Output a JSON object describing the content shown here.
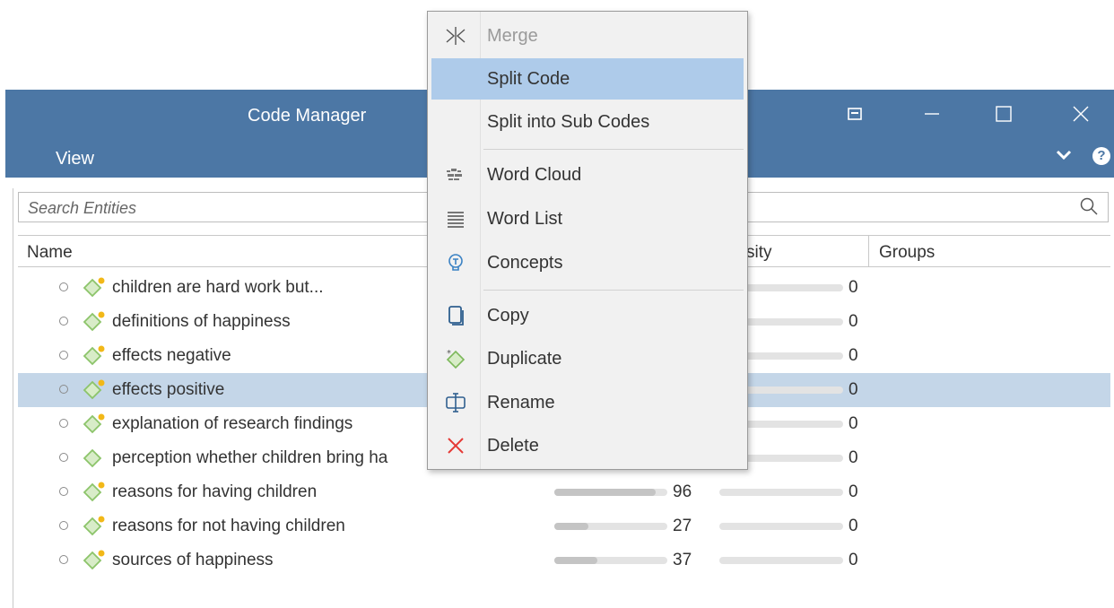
{
  "window": {
    "title": "Code Manager"
  },
  "menubar": {
    "view": "View"
  },
  "search": {
    "placeholder": "Search Entities"
  },
  "columns": {
    "name": "Name",
    "density": "sity",
    "groups": "Groups"
  },
  "rows": [
    {
      "label": "children are hard work but...",
      "grounded": "",
      "density": "0",
      "gfill": null,
      "selected": false,
      "dot": true
    },
    {
      "label": "definitions of happiness",
      "grounded": "",
      "density": "0",
      "gfill": null,
      "selected": false,
      "dot": true
    },
    {
      "label": "effects negative",
      "grounded": "",
      "density": "0",
      "gfill": null,
      "selected": false,
      "dot": true
    },
    {
      "label": "effects positive",
      "grounded": "",
      "density": "0",
      "gfill": null,
      "selected": true,
      "dot": true
    },
    {
      "label": "explanation of research findings",
      "grounded": "",
      "density": "0",
      "gfill": null,
      "selected": false,
      "dot": true
    },
    {
      "label": "perception whether children bring ha",
      "grounded": "",
      "density": "0",
      "gfill": null,
      "selected": false,
      "dot": false
    },
    {
      "label": "reasons for having children",
      "grounded": "96",
      "density": "0",
      "gfill": 0.9,
      "selected": false,
      "dot": true
    },
    {
      "label": "reasons for not having children",
      "grounded": "27",
      "density": "0",
      "gfill": 0.3,
      "selected": false,
      "dot": true
    },
    {
      "label": "sources of happiness",
      "grounded": "37",
      "density": "0",
      "gfill": 0.38,
      "selected": false,
      "dot": true
    }
  ],
  "context_menu": {
    "merge": "Merge",
    "split_code": "Split Code",
    "split_sub": "Split into Sub Codes",
    "word_cloud": "Word Cloud",
    "word_list": "Word List",
    "concepts": "Concepts",
    "copy": "Copy",
    "duplicate": "Duplicate",
    "rename": "Rename",
    "delete": "Delete"
  },
  "colors": {
    "accent": "#4c77a5",
    "highlight": "#aecbea",
    "selected_row": "#c4d6e8",
    "code_green": "#8cc46a",
    "dot_yellow": "#f2b818",
    "delete_red": "#e53935"
  }
}
